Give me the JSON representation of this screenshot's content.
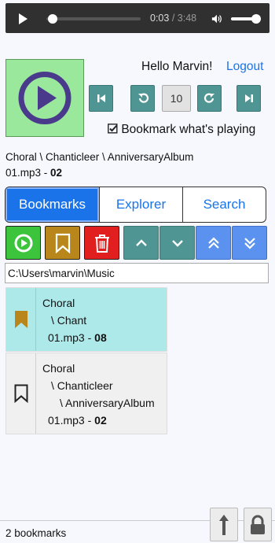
{
  "player": {
    "current_time": "0:03",
    "separator": "/",
    "duration": "3:48",
    "progress_fraction": 0.013,
    "volume_fraction": 0.85
  },
  "header": {
    "greeting": "Hello Marvin!",
    "logout_label": "Logout"
  },
  "transport": {
    "skip_seconds": "10"
  },
  "bookmark_playing": {
    "checked": true,
    "label": "Bookmark what's playing"
  },
  "now_playing": {
    "path_line1": "Choral \\ Chanticleer \\ AnniversaryAlbum",
    "file": "01.mp3",
    "dash": " - ",
    "track": "02"
  },
  "tabs": [
    {
      "label": "Bookmarks",
      "active": true
    },
    {
      "label": "Explorer",
      "active": false
    },
    {
      "label": "Search",
      "active": false
    }
  ],
  "path_input": {
    "value": "C:\\Users\\marvin\\Music"
  },
  "bookmarks": [
    {
      "lines": [
        "Choral",
        "\\ Chant"
      ],
      "file": "01.mp3",
      "track": "08",
      "selected": true
    },
    {
      "lines": [
        "Choral",
        "\\ Chanticleer",
        "\\ AnniversaryAlbum"
      ],
      "file": "01.mp3",
      "track": "02",
      "selected": false
    }
  ],
  "footer": {
    "count_label": "2 bookmarks"
  },
  "colors": {
    "accent": "#1a73e8",
    "teal": "#4e9594",
    "green": "#3cc43c",
    "gold": "#b8861b",
    "red": "#e21f1f",
    "blue_btn": "#5b92f0",
    "selected_row": "#aee9ea",
    "play_tile": "#9ae89c",
    "play_icon": "#4a3a8c"
  }
}
